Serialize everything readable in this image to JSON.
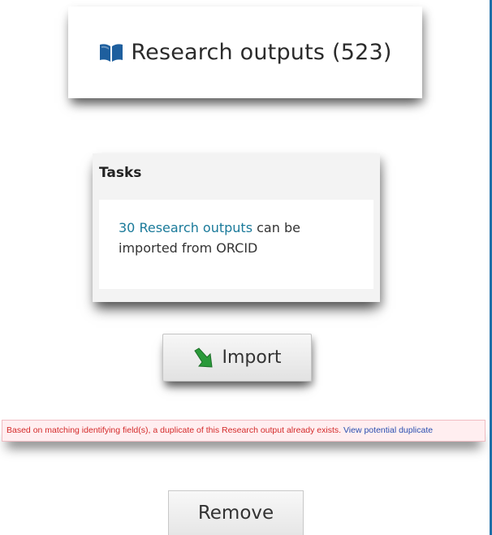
{
  "research_card": {
    "icon": "book-open-icon",
    "title": "Research outputs (523)"
  },
  "tasks_card": {
    "heading": "Tasks",
    "task": {
      "link_text": "30 Research outputs",
      "rest_text": " can be imported from ORCID"
    }
  },
  "import_button": {
    "icon": "green-arrow-down-right-icon",
    "label": "Import"
  },
  "duplicate_warning": {
    "message": "Based on matching identifying field(s), a duplicate of this Research output already exists. ",
    "link_text": "View potential duplicate"
  },
  "remove_button": {
    "label": "Remove"
  },
  "colors": {
    "link": "#1a7a9a",
    "warning_text": "#d42a2a",
    "warning_bg": "#ffeef0",
    "icon_blue": "#1e5f9e",
    "icon_green": "#2a9a3a"
  }
}
